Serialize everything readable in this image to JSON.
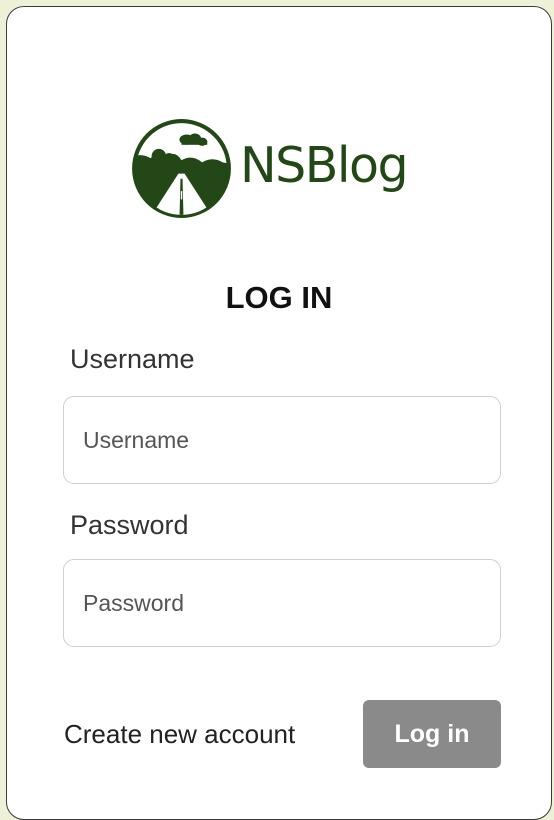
{
  "brand": {
    "name": "NSBlog",
    "logo_icon": "road-landscape-icon",
    "color": "#234716"
  },
  "form": {
    "title": "LOG IN",
    "username_label": "Username",
    "username_placeholder": "Username",
    "password_label": "Password",
    "password_placeholder": "Password",
    "create_account_label": "Create new account",
    "login_button_label": "Log in"
  },
  "colors": {
    "page_background": "#eef0d8",
    "button_background": "#8a8a8a",
    "button_text": "#ffffff"
  }
}
